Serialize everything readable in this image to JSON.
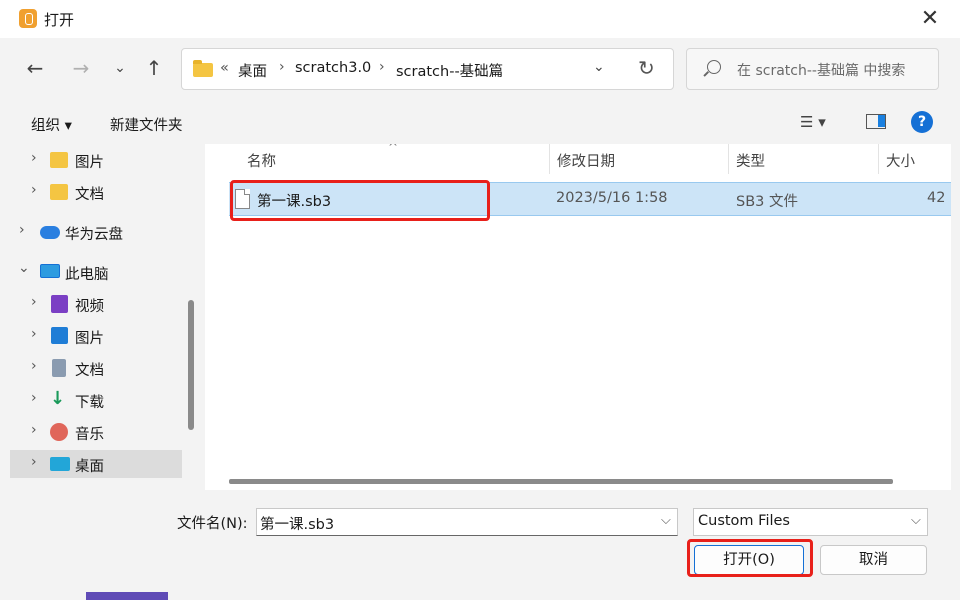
{
  "window": {
    "title": "打开",
    "close_glyph": "✕"
  },
  "nav": {
    "back_glyph": "←",
    "forward_glyph": "→",
    "recent_glyph": "⌄",
    "up_glyph": "↑",
    "breadcrumb": {
      "overflow": "«",
      "parts": [
        "桌面",
        "scratch3.0",
        "scratch--基础篇"
      ],
      "sep": "›"
    },
    "dropdown_glyph": "⌄",
    "refresh_glyph": "↻",
    "search_placeholder": "在 scratch--基础篇 中搜索"
  },
  "toolbar": {
    "organize_label": "组织 ▾",
    "new_folder_label": "新建文件夹",
    "view_glyph": "☰ ▾",
    "help_glyph": "?"
  },
  "sidebar": {
    "chevron": "›",
    "chevron_open": "⌄",
    "items": [
      {
        "label": "图片",
        "icon": "folder-icon"
      },
      {
        "label": "文档",
        "icon": "folder-icon"
      },
      {
        "label": "华为云盘",
        "icon": "cloud-icon"
      },
      {
        "label": "此电脑",
        "icon": "computer-icon"
      },
      {
        "label": "视频",
        "icon": "video-icon"
      },
      {
        "label": "图片",
        "icon": "pictures-icon"
      },
      {
        "label": "文档",
        "icon": "documents-icon"
      },
      {
        "label": "下载",
        "icon": "download-icon"
      },
      {
        "label": "音乐",
        "icon": "music-icon"
      },
      {
        "label": "桌面",
        "icon": "desktop-icon",
        "selected": true
      }
    ]
  },
  "file_list": {
    "columns": [
      "名称",
      "修改日期",
      "类型",
      "大小"
    ],
    "sort_glyph": "^",
    "rows": [
      {
        "name": "第一课.sb3",
        "modified": "2023/5/16 1:58",
        "type": "SB3 文件",
        "size": "42"
      }
    ]
  },
  "footer": {
    "filename_label": "文件名(N):",
    "filename_value": "第一课.sb3",
    "filter_value": "Custom Files",
    "open_label": "打开(O)",
    "cancel_label": "取消",
    "drop_glyph": "⌵"
  },
  "colors": {
    "selection": "#cce4f7",
    "highlight": "#e8201a",
    "accent": "#1570d5"
  }
}
